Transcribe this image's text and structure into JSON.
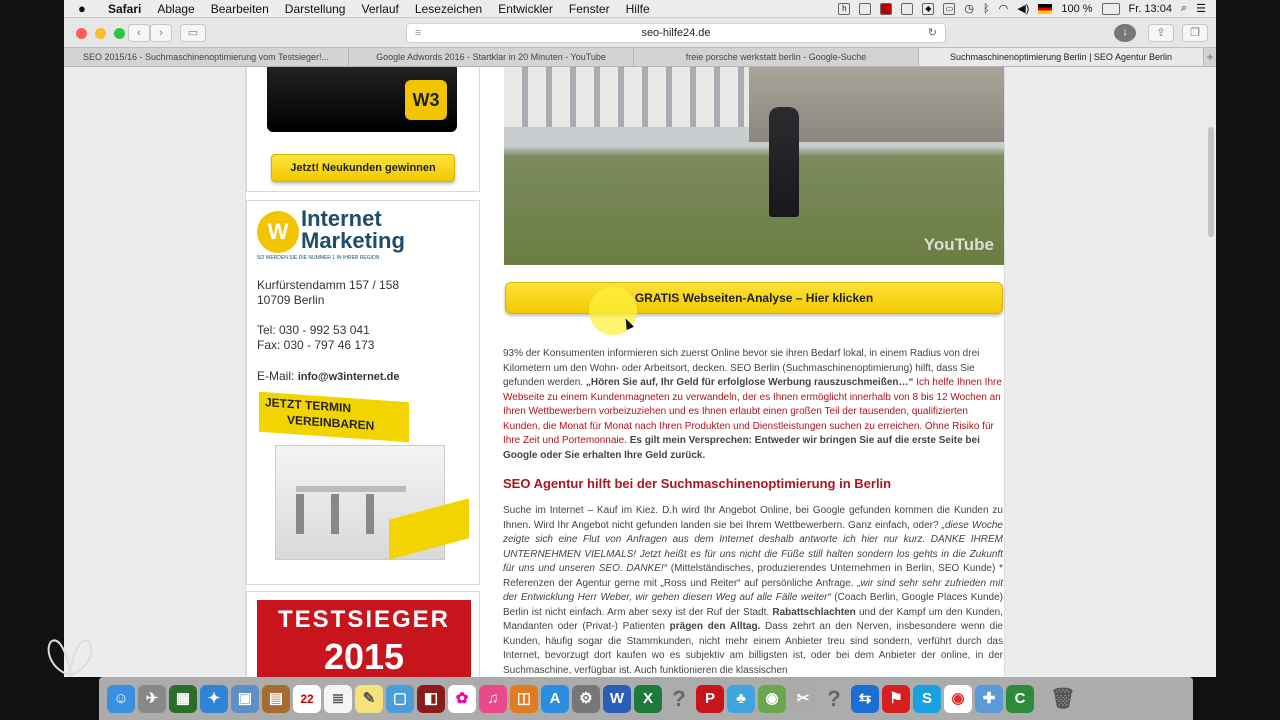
{
  "menubar": {
    "apple": "",
    "app": "Safari",
    "items": [
      "Ablage",
      "Bearbeiten",
      "Darstellung",
      "Verlauf",
      "Lesezeichen",
      "Entwickler",
      "Fenster",
      "Hilfe"
    ],
    "battery": "100 %",
    "clock": "Fr. 13:04"
  },
  "toolbar": {
    "url": "seo-hilfe24.de"
  },
  "tabs": [
    {
      "label": "SEO 2015/16 - Suchmaschinenoptimierung vom Testsieger!..."
    },
    {
      "label": "Google Adwords 2016 - Startklar in 20 Minuten - YouTube"
    },
    {
      "label": "freie porsche werkstatt berlin - Google-Suche"
    },
    {
      "label": "Suchmaschinenoptimierung Berlin | SEO Agentur Berlin"
    }
  ],
  "sidebar": {
    "w3_badge": "W3",
    "neukunden_button": "Jetzt! Neukunden gewinnen",
    "logo_line1": "Internet",
    "logo_line2": "Marketing",
    "logo_tagline": "SO WERDEN SIE DIE NUMMER 1 IN IHRER REGION",
    "street": "Kurfürstendamm 157 / 158",
    "city": "10709 Berlin",
    "tel": "Tel:  030 - 992 53 041",
    "fax": "Fax: 030 - 797 46 173",
    "email_label": "E-Mail:",
    "email": "info@w3internet.de",
    "termin_line1": "JETZT TERMIN",
    "termin_line2": "VEREINBAREN",
    "testsieger": "TESTSIEGER",
    "year": "2015"
  },
  "main": {
    "video_logo": "YouTube",
    "cta_button": "GRATIS Webseiten-Analyse – Hier klicken",
    "p1_a": "93% der Konsumenten informieren sich zuerst Online bevor sie ihren Bedarf lokal, in einem Radius von drei Kilometern um den Wohn- oder Arbeitsort, decken. SEO Berlin (Suchmaschinenoptimierung) hilft, dass Sie gefunden werden. ",
    "p1_b": "„Hören Sie auf, Ihr Geld für erfolglose Werbung rauszuschmeißen…“",
    "p1_c": "  Ich helfe Ihnen Ihre Webseite zu einem Kundenmagneten zu verwandeln, der es Ihnen ermöglicht innerhalb von 8 bis 12 Wochen an Ihren Wettbewerbern vorbeizuziehen und es Ihnen erlaubt einen großen Teil der tausenden, qualifizierten Kunden, die Monat für Monat nach Ihren Produkten und Dienstleistungen suchen zu erreichen. Ohne Risiko für Ihre Zeit und Portemonnaie.",
    "p1_d": " Es gilt mein Versprechen: Entweder wir bringen Sie auf die erste Seite bei Google oder Sie erhalten Ihre Geld zurück.",
    "heading": "SEO Agentur hilft bei der Suchmaschinenoptimierung in Berlin",
    "p2_a": "Suche im Internet – Kauf im Kiez. D.h wird Ihr Angebot Online, bei Google gefunden kommen die Kunden zu Ihnen. Wird Ihr Angebot nicht gefunden landen sie bei Ihrem Wettbewerbern. Ganz einfach, oder? ",
    "p2_b": "„diese Woche zeigte sich eine Flut von Anfragen aus dem Internet deshalb antworte ich hier nur kurz. DANKE IHREM UNTERNEHMEN VIELMALS! Jetzt heißt es für uns nicht die Füße still halten sondern los gehts in die Zukunft für uns und unseren SEO. DANKE!“",
    "p2_c": " (Mittelständisches, produzierendes Unternehmen in Berlin, SEO Kunde) * Referenzen der Agentur gerne mit „Ross und Reiter“ auf persönliche Anfrage. ",
    "p2_d": "„wir sind sehr sehr zufrieden mit der Entwicklung Herr Weber, wir gehen diesen Weg auf alle Fälle weiter“",
    "p2_e": " (Coach Berlin, Google Places Kunde) Berlin ist nicht einfach. Arm aber sexy ist der Ruf der Stadt. ",
    "p2_f": "Rabattschlachten",
    "p2_g": " und der Kampf um den Kunden, Mandanten oder (Privat-) Patienten ",
    "p2_h": "prägen den Alltag.",
    "p2_i": " Dass zehrt an den Nerven, insbesondere wenn die Kunden, häufig sogar die Stammkunden, nicht mehr einem Anbieter treu sind sondern, verführt durch das Internet, bevorzugt dort kaufen wo es subjektiv am billigsten ist, oder bei dem Anbieter der online, in der Suchmaschine, verfügbar ist. Auch funktionieren die klassischen"
  },
  "dock": {
    "icons": [
      "finder-icon",
      "launchpad-icon",
      "mission-control-icon",
      "safari-icon",
      "preview-icon",
      "contacts-icon",
      "calendar-icon",
      "reminders-icon",
      "notes-icon",
      "photo-booth-icon",
      "photos-icon",
      "itunes-icon",
      "ibooks-icon",
      "app-store-icon",
      "system-preferences-icon",
      "word-icon",
      "excel-icon",
      "help-icon",
      "acrobat-icon",
      "messages-icon",
      "network-icon",
      "utility-icon",
      "help2-icon",
      "teamviewer-icon",
      "pdf-icon",
      "skype-icon",
      "chrome-icon",
      "migration-icon",
      "camtasia-icon",
      "trash-icon"
    ],
    "calendar_day": "22"
  },
  "colors": {
    "accent_yellow": "#f5cc00",
    "heading_red": "#b0141c"
  }
}
